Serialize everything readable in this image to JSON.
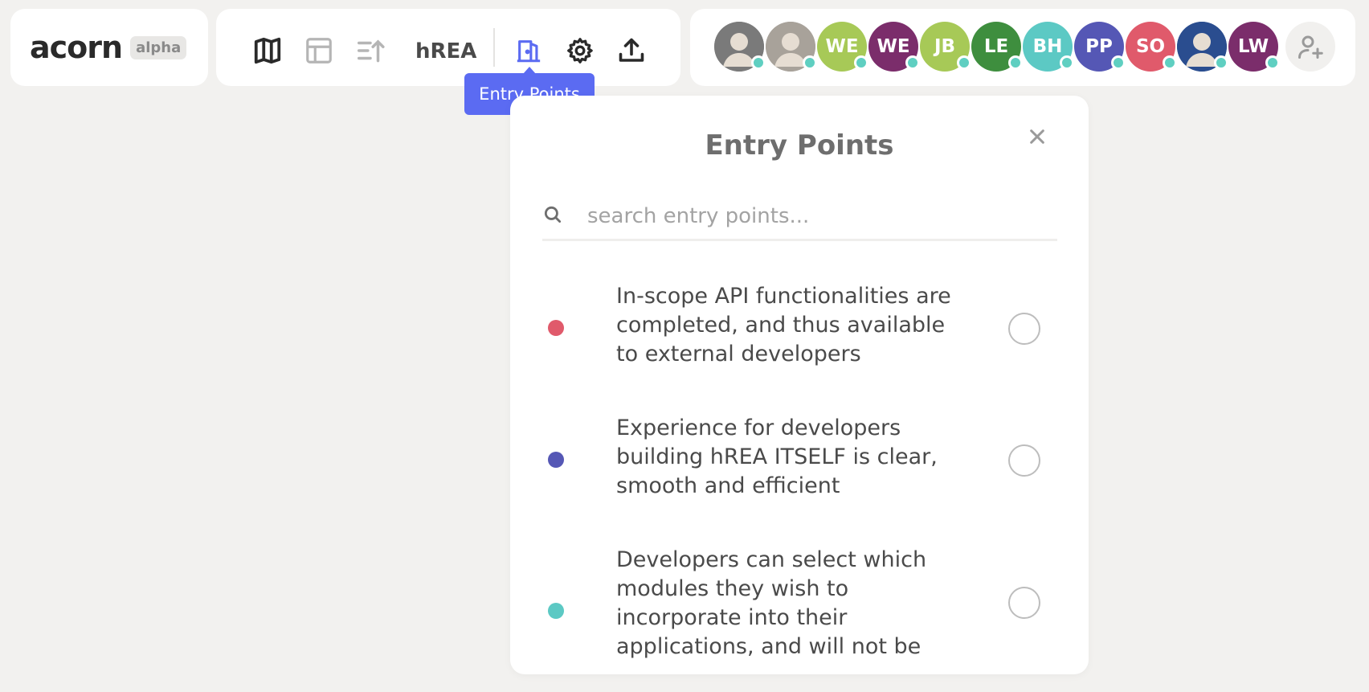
{
  "logo": {
    "name": "acorn",
    "badge": "alpha"
  },
  "toolbar": {
    "project_name": "hREA",
    "icons": [
      "map-icon",
      "table-icon",
      "priority-icon",
      "entry-points-icon",
      "settings-icon",
      "export-icon"
    ],
    "active_color": "#5b6bf2"
  },
  "tooltip": {
    "label": "Entry Points"
  },
  "members": [
    {
      "initials": "",
      "color": "#7a7a7a",
      "type": "photo"
    },
    {
      "initials": "",
      "color": "#a8a29a",
      "type": "photo"
    },
    {
      "initials": "WE",
      "color": "#a7c957"
    },
    {
      "initials": "WE",
      "color": "#7b2d6b"
    },
    {
      "initials": "JB",
      "color": "#a7c957"
    },
    {
      "initials": "LE",
      "color": "#3e8e3e"
    },
    {
      "initials": "BH",
      "color": "#5cc9c4"
    },
    {
      "initials": "PP",
      "color": "#5557b5"
    },
    {
      "initials": "SO",
      "color": "#e05a6b"
    },
    {
      "initials": "",
      "color": "#2a4d8f",
      "type": "photo"
    },
    {
      "initials": "LW",
      "color": "#7b2d6b"
    }
  ],
  "status_color": "#5fcfc1",
  "popup": {
    "title": "Entry Points",
    "search_placeholder": "search entry points...",
    "items": [
      {
        "text": "In-scope API functionalities are completed, and thus available to external developers",
        "color": "#e05a6b"
      },
      {
        "text": "Experience for developers building hREA ITSELF is clear, smooth and efficient",
        "color": "#5557b5"
      },
      {
        "text": "Developers can select which modules they wish to incorporate into their applications, and will not be",
        "color": "#5cc9c4"
      }
    ]
  }
}
